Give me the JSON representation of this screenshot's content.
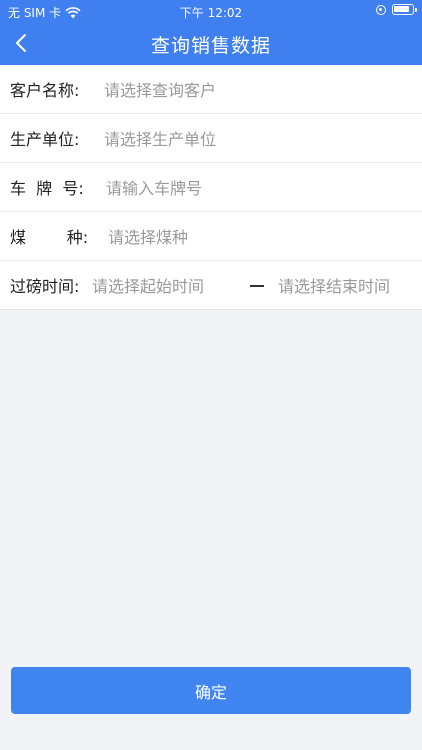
{
  "status_bar": {
    "carrier": "无 SIM 卡",
    "time": "下午 12:02"
  },
  "header": {
    "title": "查询销售数据"
  },
  "form": {
    "customer": {
      "label": "客户名称:",
      "placeholder": "请选择查询客户"
    },
    "unit": {
      "label": "生产单位:",
      "placeholder": "请选择生产单位"
    },
    "plate": {
      "label": "车  牌  号:",
      "placeholder": "请输入车牌号"
    },
    "coal": {
      "label": "煤        种:",
      "placeholder": "请选择煤种"
    },
    "time": {
      "label": "过磅时间:",
      "start_placeholder": "请选择起始时间",
      "end_placeholder": "请选择结束时间"
    }
  },
  "footer": {
    "confirm_label": "确定"
  },
  "colors": {
    "primary": "#3f7ff0",
    "background": "#f2f3f7",
    "placeholder": "#9a9a9a"
  },
  "icons": [
    "wifi-icon",
    "orientation-lock-icon",
    "battery-icon",
    "back-arrow-icon"
  ]
}
